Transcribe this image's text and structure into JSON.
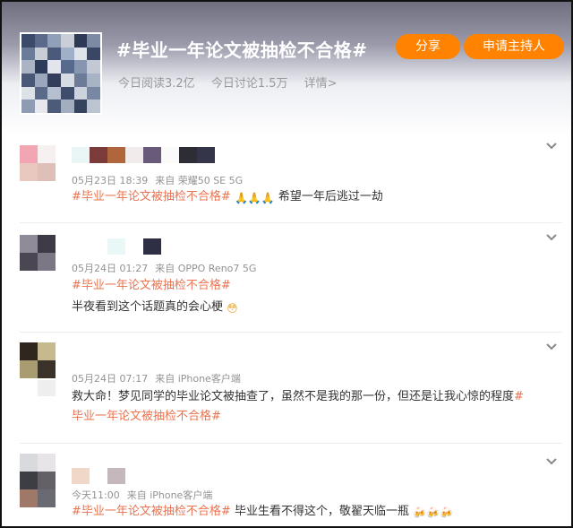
{
  "topic": {
    "title": "#毕业一年论文被抽检不合格#",
    "share_label": "分享",
    "host_label": "申请主持人",
    "reads": "今日阅读3.2亿",
    "discussions": "今日讨论1.5万",
    "details": "详情>"
  },
  "posts": [
    {
      "date": "05月23日 18:39",
      "source": "来自 荣耀50 SE 5G",
      "hashtag": "#毕业一年论文被抽检不合格#",
      "emoji": "🙏🙏🙏",
      "text": "希望一年后逃过一劫"
    },
    {
      "date": "05月24日 01:27",
      "source": "来自 OPPO Reno7 5G",
      "hashtag": "#毕业一年论文被抽检不合格#",
      "text": "半夜看到这个话题真的会心梗",
      "emoji": "😳"
    },
    {
      "date": "05月24日 07:17",
      "source": "来自 iPhone客户端",
      "text": "救大命！梦见同学的毕业论文被抽查了，虽然不是我的那一份，但还是让我心惊的程度",
      "hashtag_a": "#",
      "hashtag_b": "毕业一年论文被抽检不合格#"
    },
    {
      "date": "今天11:00",
      "source": "来自 iPhone客户端",
      "hashtag": "#毕业一年论文被抽检不合格#",
      "text": "毕业生看不得这个，敬翟天临一瓶",
      "emoji": "🍻🍻🍻"
    }
  ],
  "icons": {
    "more": "chevron-down-icon"
  }
}
